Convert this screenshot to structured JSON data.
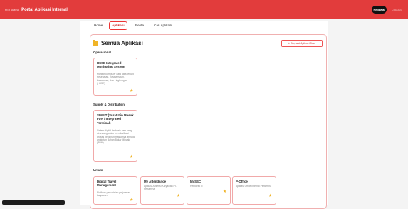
{
  "header": {
    "logo_text": "PERTAMINA",
    "title": "Portal Aplikasi Internal",
    "pegawai_label": "Pegawai",
    "logout_label": "Logout"
  },
  "nav": {
    "tabs": [
      {
        "label": "Home"
      },
      {
        "label": "Aplikasi"
      },
      {
        "label": "Berita"
      },
      {
        "label": "Cari Aplikasi"
      }
    ]
  },
  "panel": {
    "title": "Semua Aplikasi",
    "request_label": "+ Request Aplikasi Baru"
  },
  "sections": [
    {
      "title": "Operasional",
      "cards": [
        {
          "title": "HSSE Integrated Monitoring System",
          "desc": "Monitor komputer data data terkait Kesehatan, Keselamatan, Keamanan, dan Lingkungan (HSSE)"
        }
      ]
    },
    {
      "title": "Supply & Distribution",
      "cards": [
        {
          "title": "SIMFIT (Surat Izin Masuk Fuel / Integrated Terminal)",
          "desc": "Sistem digital berbasis web yang dirancang untuk memfasilitasi proses perizinan masuknya armada angkutan Bahan Bakar Minyak (BBM)"
        }
      ]
    },
    {
      "title": "Umum",
      "cards": [
        {
          "title": "Digital Travel Management",
          "desc": "Platform pencatatan perjalanan karyawan"
        },
        {
          "title": "My Attendance",
          "desc": "Aplikasi Absensi Karyawan PT. Pertamina"
        },
        {
          "title": "MySSC",
          "desc": "Helpdesk IT"
        },
        {
          "title": "P-Office",
          "desc": "Aplikasi Office Internal Pertamina"
        }
      ]
    }
  ],
  "colors": {
    "header_red": "#e23c3c",
    "accent_red": "#d03030",
    "card_border": "#f1a9a9",
    "star_yellow": "#f0b428"
  }
}
